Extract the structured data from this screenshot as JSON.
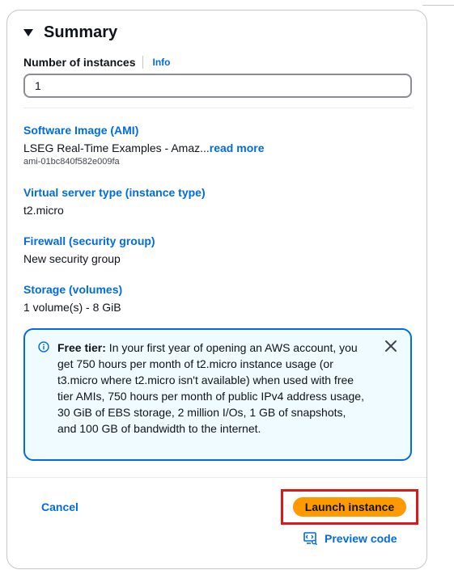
{
  "summary": {
    "title": "Summary",
    "instances_label": "Number of instances",
    "info_label": "Info",
    "instances_value": "1"
  },
  "sections": {
    "ami": {
      "label": "Software Image (AMI)",
      "value": "LSEG Real-Time Examples - Amaz...",
      "more": "read more",
      "sub": "ami-01bc840f582e009fa"
    },
    "instance_type": {
      "label": "Virtual server type (instance type)",
      "value": "t2.micro"
    },
    "firewall": {
      "label": "Firewall (security group)",
      "value": "New security group"
    },
    "storage": {
      "label": "Storage (volumes)",
      "value": "1 volume(s) - 8 GiB"
    }
  },
  "free_tier": {
    "title": "Free tier:",
    "body": " In your first year of opening an AWS account, you get 750 hours per month of t2.micro instance usage (or t3.micro where t2.micro isn't available) when used with free tier AMIs, 750 hours per month of public IPv4 address usage, 30 GiB of EBS storage, 2 million I/Os, 1 GB of snapshots, and 100 GB of bandwidth to the internet.",
    "icon": "info-circle-icon",
    "close_icon": "close-icon"
  },
  "footer": {
    "cancel_label": "Cancel",
    "launch_label": "Launch instance",
    "preview_label": "Preview code",
    "preview_icon": "code-preview-icon"
  },
  "colors": {
    "link": "#006ce0",
    "primary_button": "#ff9900",
    "highlight": "#dd1818",
    "alert_bg": "#f0fbff"
  }
}
